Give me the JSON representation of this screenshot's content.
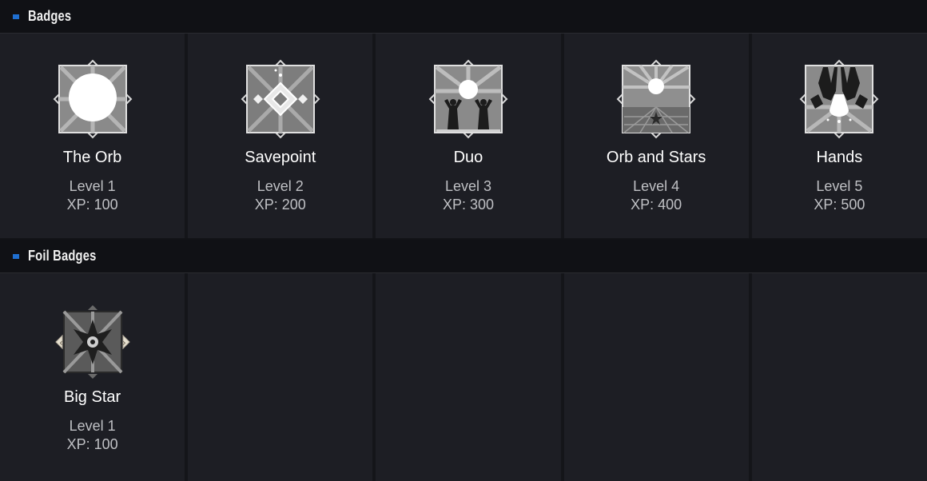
{
  "sections": [
    {
      "title": "Badges",
      "badges": [
        {
          "name": "The Orb",
          "level": "Level 1",
          "xp": "XP: 100",
          "icon": "orb-badge-icon"
        },
        {
          "name": "Savepoint",
          "level": "Level 2",
          "xp": "XP: 200",
          "icon": "savepoint-badge-icon"
        },
        {
          "name": "Duo",
          "level": "Level 3",
          "xp": "XP: 300",
          "icon": "duo-badge-icon"
        },
        {
          "name": "Orb and Stars",
          "level": "Level 4",
          "xp": "XP: 400",
          "icon": "orb-and-stars-badge-icon"
        },
        {
          "name": "Hands",
          "level": "Level 5",
          "xp": "XP: 500",
          "icon": "hands-badge-icon"
        }
      ]
    },
    {
      "title": "Foil Badges",
      "badges": [
        {
          "name": "Big Star",
          "level": "Level 1",
          "xp": "XP: 100",
          "icon": "big-star-foil-badge-icon"
        }
      ]
    }
  ],
  "colors": {
    "accent": "#1f6fd1",
    "header_bg": "#101115",
    "cell_bg": "#1d1e24",
    "text_muted": "#bfc0c4"
  }
}
